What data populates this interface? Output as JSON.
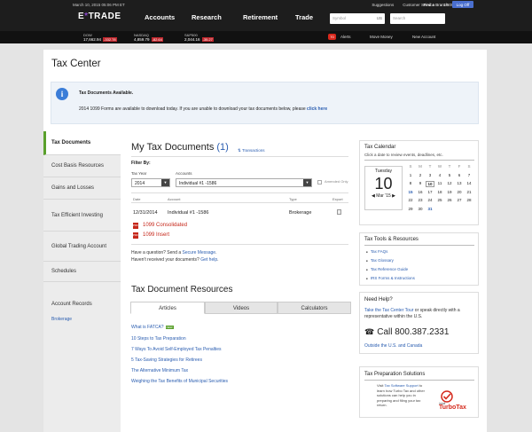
{
  "header": {
    "datetime": "March 10, 2015 05:06 PM ET",
    "utility": [
      "Suggestions",
      "Customer Service",
      "1-800-387-2331"
    ],
    "find_branch": "Find a Branch",
    "logoff": "Log Off",
    "logo_pre": "E",
    "logo_mark": "*",
    "logo_post": "TRADE",
    "nav": [
      "Accounts",
      "Research",
      "Retirement",
      "Trade"
    ],
    "symbol_placeholder": "Symbol",
    "symbol_market": "US",
    "search_placeholder": "Search"
  },
  "tickers": [
    {
      "name": "DOW",
      "value": "17,662.94",
      "change": "-332.78"
    },
    {
      "name": "NASDAQ",
      "value": "4,859.79",
      "change": "-82.64"
    },
    {
      "name": "S&P500",
      "value": "2,044.16",
      "change": "-35.27"
    }
  ],
  "alerts": {
    "count": "70",
    "label": "Alerts"
  },
  "right_links": [
    "Move Money",
    "New Account"
  ],
  "page_title": "Tax Center",
  "notice": {
    "title": "Tax Documents Available.",
    "body": "2014 1099 Forms are available to download today. If you are unable to download your tax documents below, please ",
    "link": "click here"
  },
  "sidebar": {
    "items": [
      "Tax Documents",
      "Cost Basis Resources",
      "Gains and Losses",
      "Tax Efficient Investing",
      "Global Trading Account",
      "Schedules",
      "Account Records"
    ],
    "sub_link": "Brokerage"
  },
  "documents": {
    "title": "My Tax Documents",
    "count": "(1)",
    "transactions_link": "Transactions",
    "filter_label": "Filter By:",
    "tax_year_label": "Tax Year",
    "tax_year": "2014",
    "accounts_label": "Accounts",
    "account": "Individual #1 -1586",
    "amended_label": "Amended Only",
    "columns": [
      "Date",
      "Account",
      "Type",
      "Export"
    ],
    "row": {
      "date": "12/31/2014",
      "account": "Individual #1 -1586",
      "type": "Brokerage"
    },
    "files": [
      "1099 Consolidated",
      "1099 Insert"
    ],
    "question_pre": "Have a question? Send a ",
    "question_link": "Secure Message",
    "received_pre": "Haven't received your documents? ",
    "received_link": "Get help"
  },
  "resources": {
    "title": "Tax Document Resources",
    "tabs": [
      "Articles",
      "Videos",
      "Calculators"
    ],
    "articles": [
      "What is FATCA?",
      "10 Steps to Tax Preparation",
      "7 Ways To Avoid Self-Employed Tax Penalties",
      "5 Tax-Saving Strategies for Retirees",
      "The Alternative Minimum Tax",
      "Weighing the Tax Benefits of Municipal Securities"
    ],
    "new_badge": "NEW"
  },
  "calendar": {
    "title": "Tax Calendar",
    "subtitle": "Click a date to review events, deadlines, etc.",
    "weekday": "Tuesday",
    "day": "10",
    "month": "Mar '15",
    "weekday_headers": [
      "S",
      "M",
      "T",
      "W",
      "T",
      "F",
      "S"
    ],
    "days": [
      "1",
      "2",
      "3",
      "4",
      "5",
      "6",
      "7",
      "8",
      "9",
      "10",
      "11",
      "12",
      "13",
      "14",
      "15",
      "16",
      "17",
      "18",
      "19",
      "20",
      "21",
      "22",
      "23",
      "24",
      "25",
      "26",
      "27",
      "28",
      "29",
      "30",
      "31"
    ]
  },
  "tools": {
    "title": "Tax Tools & Resources",
    "items": [
      "Tax FAQs",
      "Tax Glossary",
      "Tax Reference Guide",
      "IRS Forms & Instructions"
    ]
  },
  "help": {
    "title": "Need Help?",
    "text_link": "Take the Tax Center Tour",
    "text_rest": " or speak directly with a representative within the U.S.",
    "phone": "Call 800.387.2331",
    "outside": "Outside the U.S. and Canada"
  },
  "prep": {
    "title": "Tax Preparation Solutions",
    "text_pre": "Visit ",
    "text_link": "Tax Software Support",
    "text_post": " to learn how Turbo Tax and other solutions can help you in preparing and filing your tax return.",
    "logo": "TurboTax",
    "logo_brand": "intuit"
  },
  "colors": {
    "accent_green": "#5aa02c",
    "link_blue": "#2a5db0",
    "pdf_red": "#c6281b",
    "header": "#1d1d1d"
  }
}
